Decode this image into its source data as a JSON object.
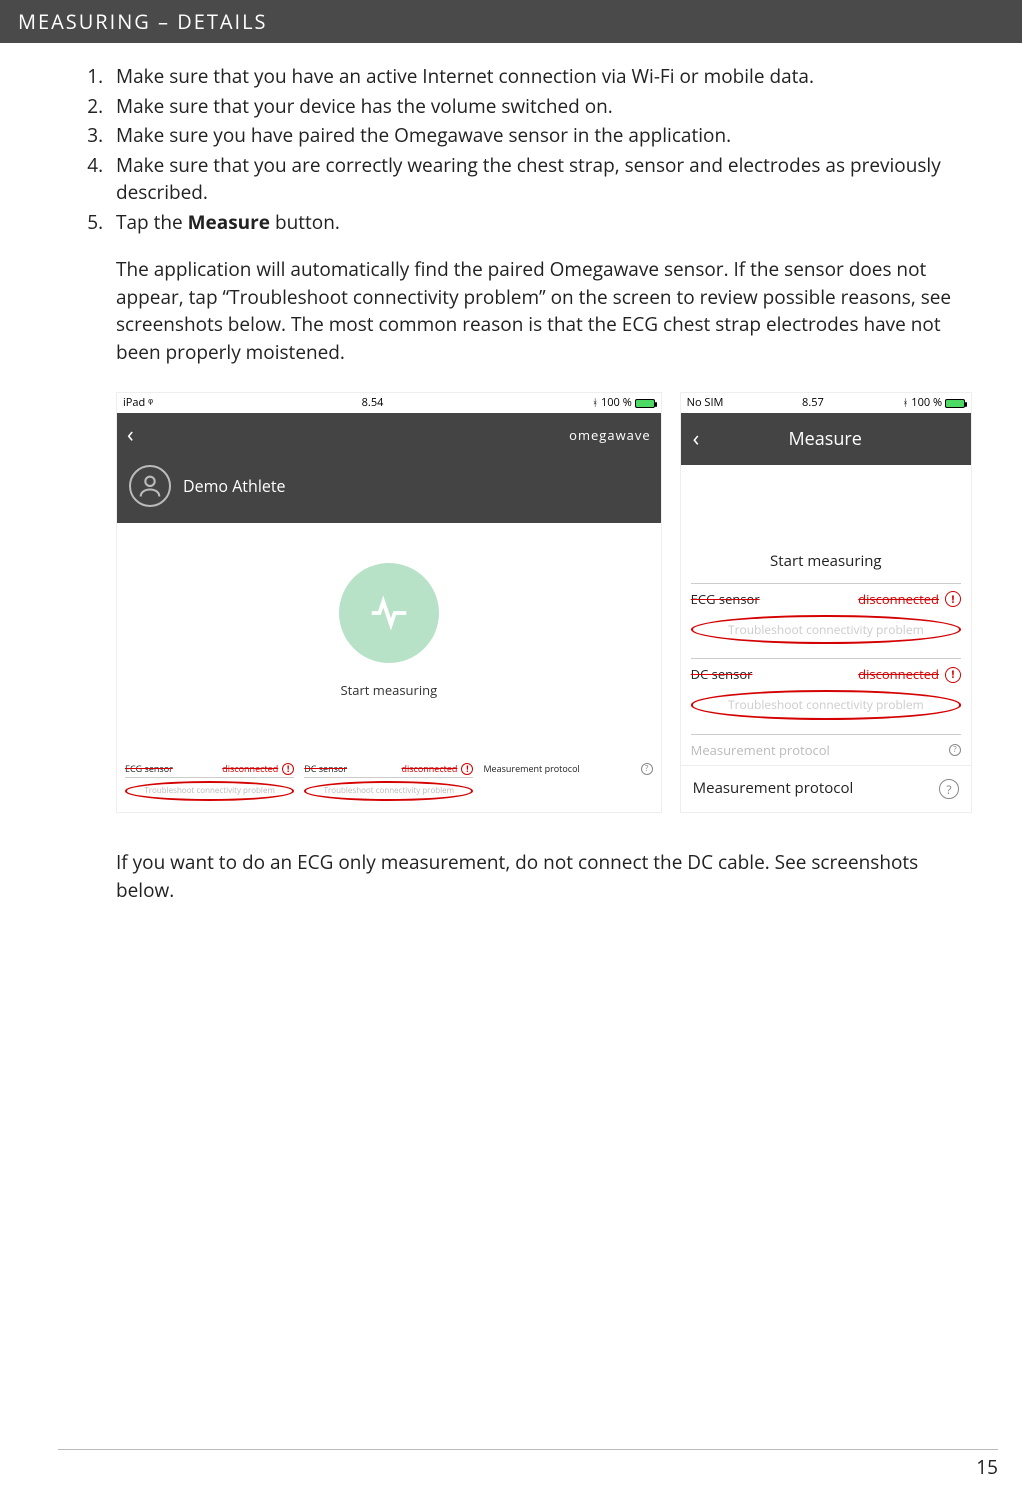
{
  "header": "MEASURING – DETAILS",
  "steps": [
    "Make sure that you have an active Internet connection via Wi-Fi or mobile data.",
    "Make sure that your device has the volume switched on.",
    "Make sure you have paired the Omegawave sensor in the application.",
    "Make sure that you are correctly wearing the chest strap, sensor and electrodes as previously described."
  ],
  "step5_prefix": "Tap the ",
  "step5_bold": "Measure",
  "step5_suffix": " button.",
  "para1": "The application will automatically find the paired Omegawave sensor. If the sensor does not appear, tap “Troubleshoot connectivity problem” on the screen to review possible reasons, see screenshots below. The most common reason is that the ECG chest strap electrodes have not been properly moistened.",
  "para2": "If you want to do an ECG only measurement, do not connect the DC cable. See screenshots below.",
  "page_number": "15",
  "ipad": {
    "status_left": "iPad ᵠ",
    "status_time": "8.54",
    "status_right": "100 %",
    "brand": "omegawave",
    "user": "Demo Athlete",
    "start": "Start measuring",
    "ecg_label": "ECG sensor",
    "dc_label": "DC sensor",
    "disconnected": "disconnected",
    "trouble": "Troubleshoot connectivity problem",
    "protocol": "Measurement protocol"
  },
  "phone": {
    "status_left": "No SIM",
    "status_time": "8.57",
    "status_right": "100 %",
    "title": "Measure",
    "start": "Start measuring",
    "ecg_label": "ECG sensor",
    "dc_label": "DC sensor",
    "disconnected": "disconnected",
    "trouble": "Troubleshoot connectivity problem",
    "protocol": "Measurement protocol"
  }
}
